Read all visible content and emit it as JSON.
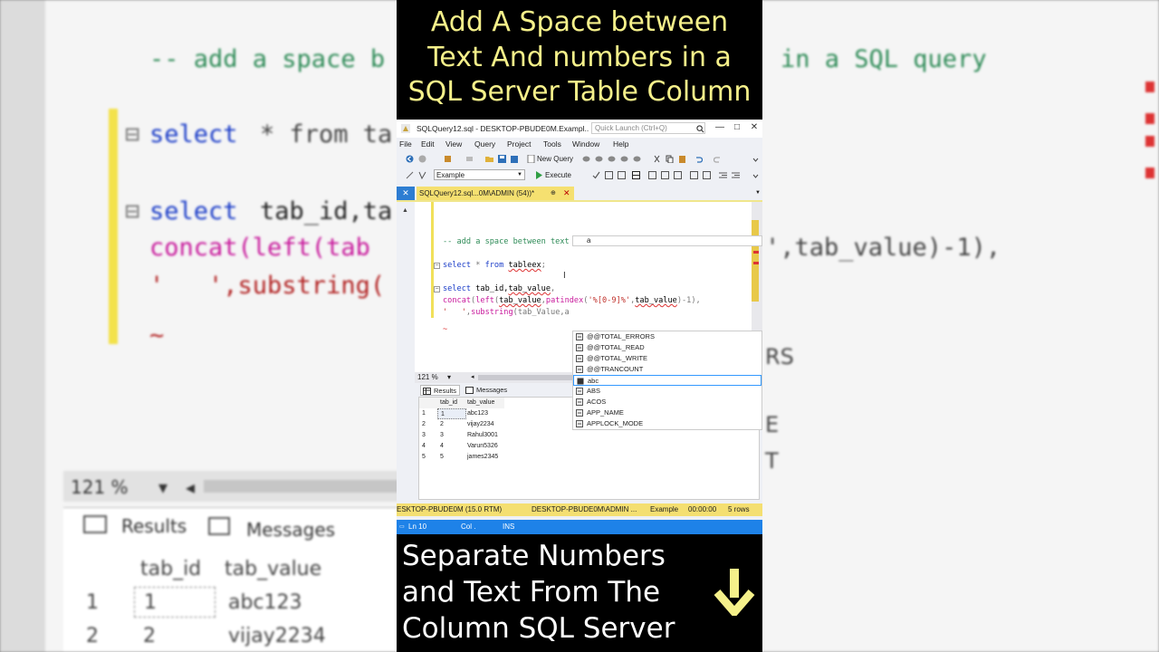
{
  "background": {
    "comment": "-- add a space b",
    "comment_right": "in a SQL query",
    "line1_kw": "select",
    "line1_rest": "* from ta",
    "line2_kw": "select",
    "line2_rest": "tab_id,ta",
    "line3_fn": "concat(left(tab",
    "line3_right": "',tab_value)-1),",
    "line4": "'   ',substring(",
    "zoom": "121 %",
    "results_tab": "Results",
    "messages_tab": "Messages",
    "col_id": "tab_id",
    "col_value": "tab_value",
    "rows": [
      {
        "n": "1",
        "id": "1",
        "value": "abc123"
      },
      {
        "n": "2",
        "id": "2",
        "value": "vijay2234"
      }
    ],
    "right_frag1": "RS",
    "right_frag2": "E",
    "right_frag3": "T"
  },
  "top_banner": {
    "lines": [
      "Add A Space between",
      "Text And numbers in a",
      "SQL Server Table Column"
    ]
  },
  "bottom_banner": {
    "lines": [
      "Separate Numbers",
      "and Text From The",
      "Column SQL Server"
    ],
    "arrow_icon": "down-arrow-icon"
  },
  "window": {
    "title": "SQLQuery12.sql - DESKTOP-PBUDE0M.Exampl...",
    "quick_launch_placeholder": "Quick Launch (Ctrl+Q)",
    "controls": [
      "—",
      "□",
      "✕"
    ],
    "menu": [
      "File",
      "Edit",
      "View",
      "Query",
      "Project",
      "Tools",
      "Window",
      "Help"
    ],
    "new_query_label": "New Query",
    "database": "Example",
    "execute_label": "Execute",
    "doc_tab": "SQLQuery12.sql...0M\\ADMIN (54))*",
    "pin_glyph": "⊕",
    "close_glyph": "✕",
    "side_close": "✕"
  },
  "editor": {
    "comment": "-- add a space between text and numbers in a SQL query",
    "l1_kw": "select",
    "l1_rest": " * ",
    "l1_from": "from",
    "l1_table": "tableex",
    "l1_semi": ";",
    "l2_kw": "select",
    "l2_rest": " tab_id,",
    "l2_col": "tab_value",
    "l2_comma": ",",
    "l3_concat": "concat",
    "l3_open": "(",
    "l3_left": "left",
    "l3_open2": "(",
    "l3_arg": "tab_value",
    "l3_comma": ",",
    "l3_patindex": "patindex",
    "l3_open3": "(",
    "l3_pattern": "'%[0-9]%'",
    "l3_comma2": ",",
    "l3_arg2": "tab_value",
    "l3_close": ")-1),",
    "l4_str": "'   '",
    "l4_comma": ",",
    "l4_fn": "substring",
    "l4_rest": "(tab_Value,a",
    "squiggle": "~",
    "param_tip": "a",
    "zoom": "121 %"
  },
  "autocomplete": {
    "items": [
      {
        "label": "@@TOTAL_ERRORS",
        "kind": "function",
        "selected": false
      },
      {
        "label": "@@TOTAL_READ",
        "kind": "function",
        "selected": false
      },
      {
        "label": "@@TOTAL_WRITE",
        "kind": "function",
        "selected": false
      },
      {
        "label": "@@TRANCOUNT",
        "kind": "function",
        "selected": false
      },
      {
        "label": "abc",
        "kind": "text",
        "selected": true
      },
      {
        "label": "ABS",
        "kind": "function",
        "selected": false
      },
      {
        "label": "ACOS",
        "kind": "function",
        "selected": false
      },
      {
        "label": "APP_NAME",
        "kind": "function",
        "selected": false
      },
      {
        "label": "APPLOCK_MODE",
        "kind": "function",
        "selected": false
      }
    ]
  },
  "results": {
    "results_tab": "Results",
    "messages_tab": "Messages",
    "columns": [
      "tab_id",
      "tab_value"
    ],
    "rows": [
      {
        "n": "1",
        "id": "1",
        "value": "abc123"
      },
      {
        "n": "2",
        "id": "2",
        "value": "vijay2234"
      },
      {
        "n": "3",
        "id": "3",
        "value": "Rahul3001"
      },
      {
        "n": "4",
        "id": "4",
        "value": "Varun5326"
      },
      {
        "n": "5",
        "id": "5",
        "value": "james2345"
      }
    ]
  },
  "query_status": {
    "server": "ESKTOP-PBUDE0M (15.0 RTM)",
    "user": "DESKTOP-PBUDE0M\\ADMIN ...",
    "database": "Example",
    "time": "00:00:00",
    "rows": "5 rows"
  },
  "ide_status": {
    "line": "Ln 10",
    "col": "Col .",
    "mode": "INS"
  },
  "colors": {
    "banner_text": "#f5f08a",
    "keyword": "#1a3cc8",
    "function": "#c81a9c",
    "string": "#c0312b",
    "comment": "#2e8b57",
    "status_yellow": "#f4df71",
    "status_blue": "#1e82e8"
  }
}
